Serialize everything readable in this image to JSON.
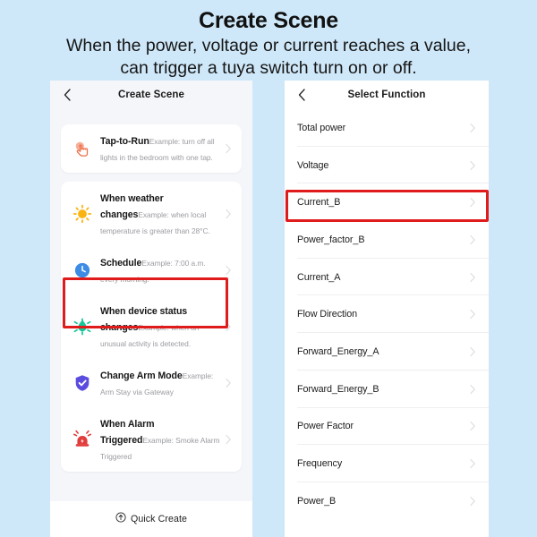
{
  "header": {
    "title": "Create Scene",
    "subtitle_line1": "When the power, voltage or current reaches a value,",
    "subtitle_line2": "can trigger a tuya switch turn on or off."
  },
  "colors": {
    "page_background": "#cfe8f9",
    "panel_background": "#f5f6fa",
    "card_background": "#ffffff",
    "highlight_red": "#e01b1b",
    "tap_to_run_icon": "#ee6c45",
    "weather_icon": "#f9b412",
    "schedule_icon": "#3c8ce6",
    "device_status_icon": "#16c79a",
    "arm_mode_icon": "#5b4ce0",
    "alarm_icon": "#e23b3b",
    "title_text": "#171717",
    "desc_text": "#9b9ca1"
  },
  "left_panel": {
    "nav": {
      "back_icon": "chevron-left-icon",
      "title": "Create Scene"
    },
    "cards": [
      {
        "rows": [
          {
            "icon": "tap-hand-icon",
            "title": "Tap-to-Run",
            "desc": "Example: turn off all lights in the bedroom with one tap.",
            "highlighted": false
          }
        ]
      },
      {
        "rows": [
          {
            "icon": "sun-icon",
            "title": "When weather changes",
            "desc": "Example: when local temperature is greater than 28°C.",
            "highlighted": false
          },
          {
            "icon": "clock-icon",
            "title": "Schedule",
            "desc": "Example: 7:00 a.m. every morning.",
            "highlighted": false
          },
          {
            "icon": "device-sensor-icon",
            "title": "When device status changes",
            "desc": "Example: when an unusual activity is detected.",
            "highlighted": true
          },
          {
            "icon": "shield-check-icon",
            "title": "Change Arm Mode",
            "desc": "Example: Arm Stay via Gateway",
            "highlighted": false
          },
          {
            "icon": "alarm-siren-icon",
            "title": "When Alarm Triggered",
            "desc": "Example: Smoke Alarm Triggered",
            "highlighted": false
          }
        ]
      }
    ],
    "footer": {
      "icon": "circle-arrow-up-icon",
      "label": "Quick Create"
    }
  },
  "right_panel": {
    "nav": {
      "back_icon": "chevron-left-icon",
      "title": "Select Function"
    },
    "functions": [
      {
        "label": "Total power",
        "highlighted": false
      },
      {
        "label": "Voltage",
        "highlighted": false
      },
      {
        "label": "Current_B",
        "highlighted": true
      },
      {
        "label": "Power_factor_B",
        "highlighted": false
      },
      {
        "label": "Current_A",
        "highlighted": false
      },
      {
        "label": "Flow Direction",
        "highlighted": false
      },
      {
        "label": "Forward_Energy_A",
        "highlighted": false
      },
      {
        "label": "Forward_Energy_B",
        "highlighted": false
      },
      {
        "label": "Power Factor",
        "highlighted": false
      },
      {
        "label": "Frequency",
        "highlighted": false
      },
      {
        "label": "Power_B",
        "highlighted": false
      }
    ]
  }
}
